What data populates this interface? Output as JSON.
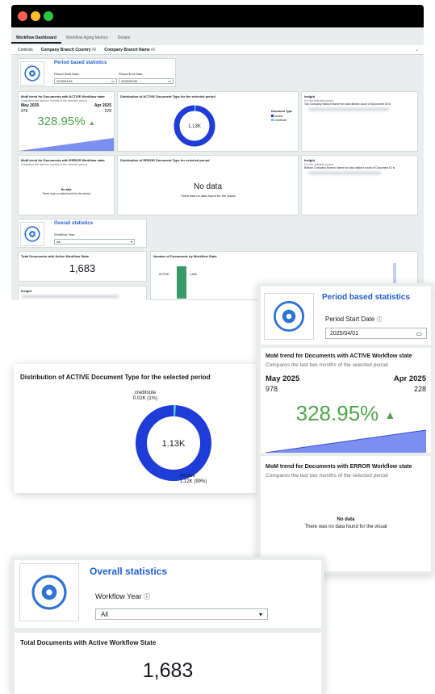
{
  "window": {
    "dots": [
      "#ff5f57",
      "#febc2e",
      "#28c840"
    ]
  },
  "tabs": [
    "Workflow Dashboard",
    "Workflow Aging Metrics",
    "Details"
  ],
  "controls": {
    "label": "Controls",
    "country_label": "Company Branch Country",
    "country_value": "All",
    "name_label": "Company Branch Name",
    "name_value": "All"
  },
  "period": {
    "title": "Period based statistics",
    "start_label": "Period Start Date",
    "start_value": "2025/04/01",
    "end_label": "Period End Date",
    "end_value": "2025/05/30"
  },
  "active_trend": {
    "title": "MoM trend for Documents with ACTIVE Workflow state",
    "subtitle": "Compares the last two months of the selected period",
    "month_current": "May 2025",
    "month_prev": "Apr 2025",
    "value_current": "978",
    "value_prev": "228",
    "change": "328.95%",
    "accent": "#4fa64a",
    "area_color": "#7b8ff0"
  },
  "active_dist": {
    "title": "Distribution of ACTIVE Document Type for the selected period",
    "center_label": "1.13K",
    "legend_title": "Document Type",
    "slices": [
      {
        "name": "creditnote",
        "label": "0.02K (1%)",
        "value": 20,
        "color": "#5ec4e0"
      },
      {
        "name": "invoice",
        "label": "1.12K (99%)",
        "value": 1120,
        "color": "#1d3cd8"
      }
    ]
  },
  "insight_top": {
    "title": "Insight",
    "sub": "For the selected period",
    "text": "Top Company Branch Name for total distinct count of Document ID is"
  },
  "error_trend": {
    "title": "MoM trend for Documents with ERROR Workflow state",
    "subtitle": "Compares the last two months of the selected period",
    "no_data": "No data",
    "no_data_sub": "There was no data found for the visual"
  },
  "error_dist": {
    "title": "Distribution of ERROR Document Type for selected period",
    "no_data": "No data",
    "no_data_sub": "There was no data found for the visual"
  },
  "insight_bottom": {
    "title": "Insight",
    "sub": "For the selected period",
    "text": "Bottom Company Branch Name for total distinct count of Document ID is"
  },
  "overall": {
    "title": "Overall statistics",
    "year_label": "Workflow Year",
    "year_value": "All"
  },
  "total_active": {
    "title": "Total Documents with Active Workflow State",
    "value": "1,683"
  },
  "by_state": {
    "title": "Number of Documents by Workflow State",
    "bar_label": "ACTIVE",
    "bar_value": "1,683"
  },
  "insight_small": {
    "title": "Insight"
  },
  "icons": {
    "gear": "gear-refresh-icon",
    "calendar": "calendar-icon",
    "info": "info-icon",
    "caret": "triangle-up-icon",
    "dropdown": "chevron-down-icon"
  }
}
